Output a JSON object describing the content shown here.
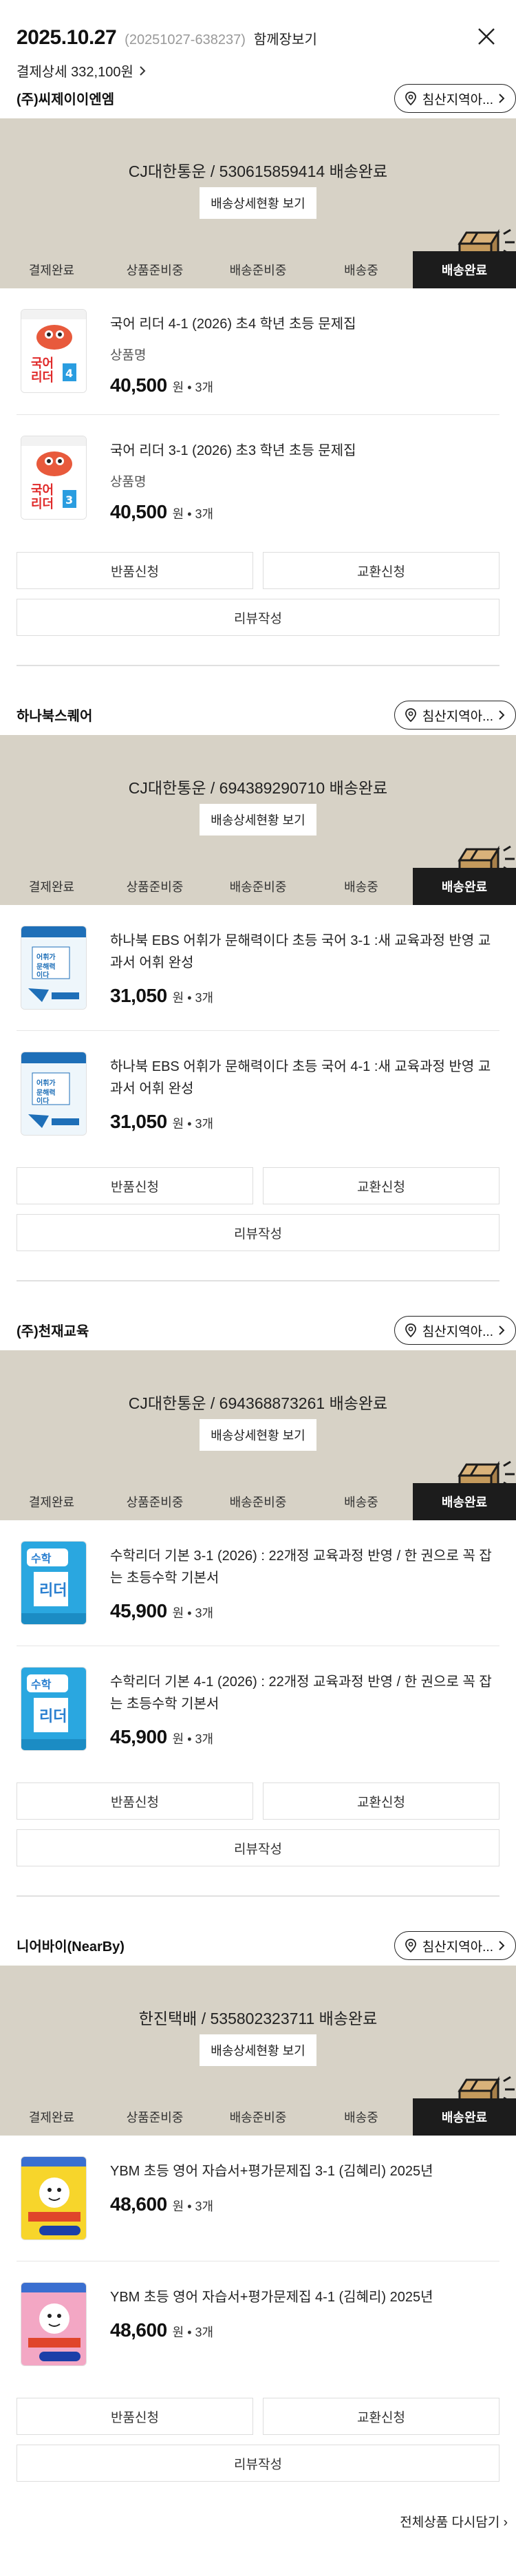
{
  "header": {
    "date": "2025.10.27",
    "order_no": "(20251027-638237)",
    "together": "함께장보기",
    "payment": "결제상세 332,100원"
  },
  "colors": {
    "delivery_bg": "#d7d2c6",
    "active_step": "#1c1c1c"
  },
  "steps": [
    "결제완료",
    "상품준비중",
    "배송준비중",
    "배송중",
    "배송완료"
  ],
  "track_label": "배송상세현황 보기",
  "location_label": "침산지역아...",
  "buttons": {
    "return": "반품신청",
    "exchange": "교환신청",
    "review": "리뷰작성"
  },
  "qty_text": "원 • 3개",
  "sellers": [
    {
      "name": "(주)씨제이이엔엠",
      "carrier": "CJ대한통운 / 530615859414 배송완료",
      "items": [
        {
          "title": "국어 리더 4-1 (2026) 초4 학년 초등 문제집",
          "option": "상품명",
          "price": "40,500",
          "cover": "korean-4"
        },
        {
          "title": "국어 리더 3-1 (2026) 초3 학년 초등 문제집",
          "option": "상품명",
          "price": "40,500",
          "cover": "korean-3"
        }
      ]
    },
    {
      "name": "하나북스퀘어",
      "carrier": "CJ대한통운 / 694389290710 배송완료",
      "items": [
        {
          "title": "하나북 EBS 어휘가 문해력이다 초등 국어 3-1 :새 교육과정 반영 교과서 어휘 완성",
          "option": "",
          "price": "31,050",
          "cover": "ebs"
        },
        {
          "title": "하나북 EBS 어휘가 문해력이다 초등 국어 4-1 :새 교육과정 반영 교과서 어휘 완성",
          "option": "",
          "price": "31,050",
          "cover": "ebs"
        }
      ]
    },
    {
      "name": "(주)천재교육",
      "carrier": "CJ대한통운 / 694368873261 배송완료",
      "items": [
        {
          "title": "수학리더 기본 3-1 (2026) : 22개정 교육과정 반영 / 한 권으로 꼭 잡는 초등수학 기본서",
          "option": "",
          "price": "45,900",
          "cover": "math"
        },
        {
          "title": "수학리더 기본 4-1 (2026) : 22개정 교육과정 반영 / 한 권으로 꼭 잡는 초등수학 기본서",
          "option": "",
          "price": "45,900",
          "cover": "math"
        }
      ]
    },
    {
      "name": "니어바이(NearBy)",
      "carrier": "한진택배 / 535802323711 배송완료",
      "items": [
        {
          "title": "YBM 초등 영어 자습서+평가문제집 3-1 (김혜리) 2025년",
          "option": "",
          "price": "48,600",
          "cover": "ybm-yellow"
        },
        {
          "title": "YBM 초등 영어 자습서+평가문제집 4-1 (김혜리) 2025년",
          "option": "",
          "price": "48,600",
          "cover": "ybm-pink"
        }
      ]
    }
  ],
  "footer": {
    "reorder_all": "전체상품 다시담기"
  }
}
